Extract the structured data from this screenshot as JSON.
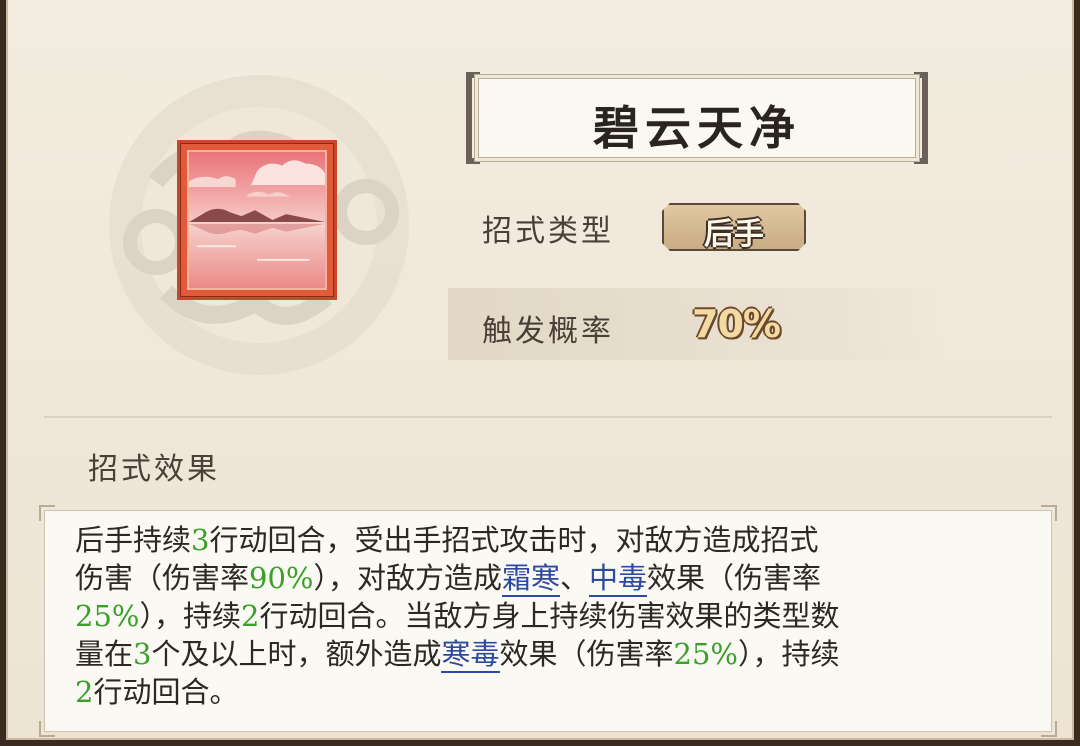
{
  "skill": {
    "name": "碧云天净",
    "type_label": "招式类型",
    "type_value": "后手",
    "prob_label": "触发概率",
    "prob_value": "70%"
  },
  "effect": {
    "section_title": "招式效果",
    "line1": {
      "a": "后手持续",
      "n1": "3",
      "b": "行动回合，受出手招式攻击时，对敌方造成招式"
    },
    "line2": {
      "a": "伤害（伤害率",
      "n1": "90%",
      "b": "），对敌方造成",
      "kw1": "霜寒",
      "c": "、",
      "kw2": "中毒",
      "d": "效果（伤害率"
    },
    "line3": {
      "n1": "25%",
      "a": "），持续",
      "n2": "2",
      "b": "行动回合。当敌方身上持续伤害效果的类型数"
    },
    "line4": {
      "a": "量在",
      "n1": "3",
      "b": "个及以上时，额外造成",
      "kw1": "寒毒",
      "c": "效果（伤害率",
      "n2": "25%",
      "d": "），持续"
    },
    "line5": {
      "n1": "2",
      "a": "行动回合。"
    }
  },
  "colors": {
    "highlight_number": "#3aa02a",
    "keyword": "#2b4aa0",
    "icon_border": "#c44a2e"
  }
}
